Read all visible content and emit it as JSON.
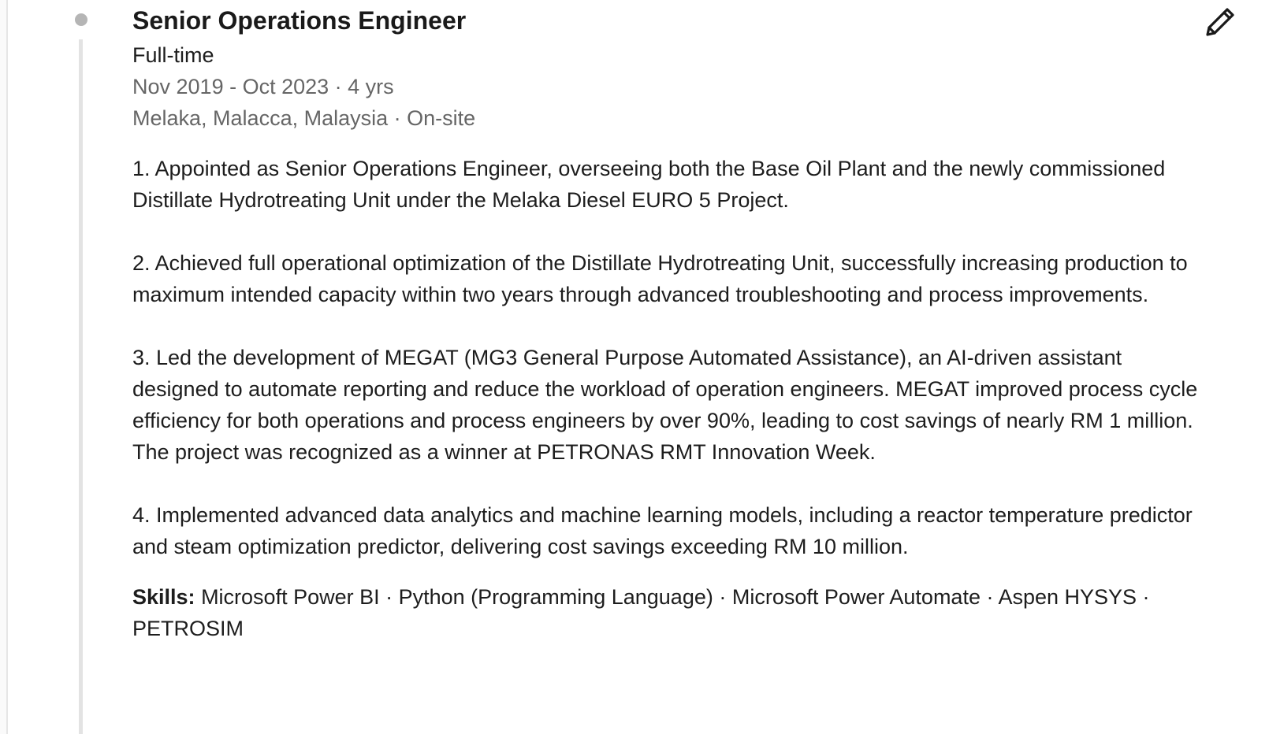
{
  "experience": {
    "title": "Senior Operations Engineer",
    "employment_type": "Full-time",
    "dates": "Nov 2019 - Oct 2023 · 4 yrs",
    "location": "Melaka, Malacca, Malaysia · On-site",
    "description": [
      "1. Appointed as Senior Operations Engineer, overseeing both the Base Oil Plant and the newly commissioned Distillate Hydrotreating Unit under the Melaka Diesel EURO 5 Project.",
      "2. Achieved full operational optimization of the Distillate Hydrotreating Unit, successfully increasing production to maximum intended capacity within two years through advanced troubleshooting and process improvements.",
      "3. Led the development of MEGAT (MG3 General Purpose Automated Assistance), an AI-driven assistant designed to automate reporting and reduce the workload of operation engineers. MEGAT improved process cycle efficiency for both operations and process engineers by over 90%, leading to cost savings of nearly RM 1 million. The project was recognized as a winner at PETRONAS RMT Innovation Week.",
      "4. Implemented advanced data analytics and machine learning models, including a reactor temperature predictor and steam optimization predictor, delivering cost savings exceeding RM 10 million."
    ],
    "skills_label": "Skills:",
    "skills": "Microsoft Power BI · Python (Programming Language) · Microsoft Power Automate · Aspen HYSYS · PETROSIM"
  },
  "icons": {
    "edit": "pencil-icon"
  },
  "colors": {
    "text": "#1d1d1d",
    "muted": "#666666",
    "timeline": "#e3e3e3",
    "dot": "#b5b5b5"
  }
}
